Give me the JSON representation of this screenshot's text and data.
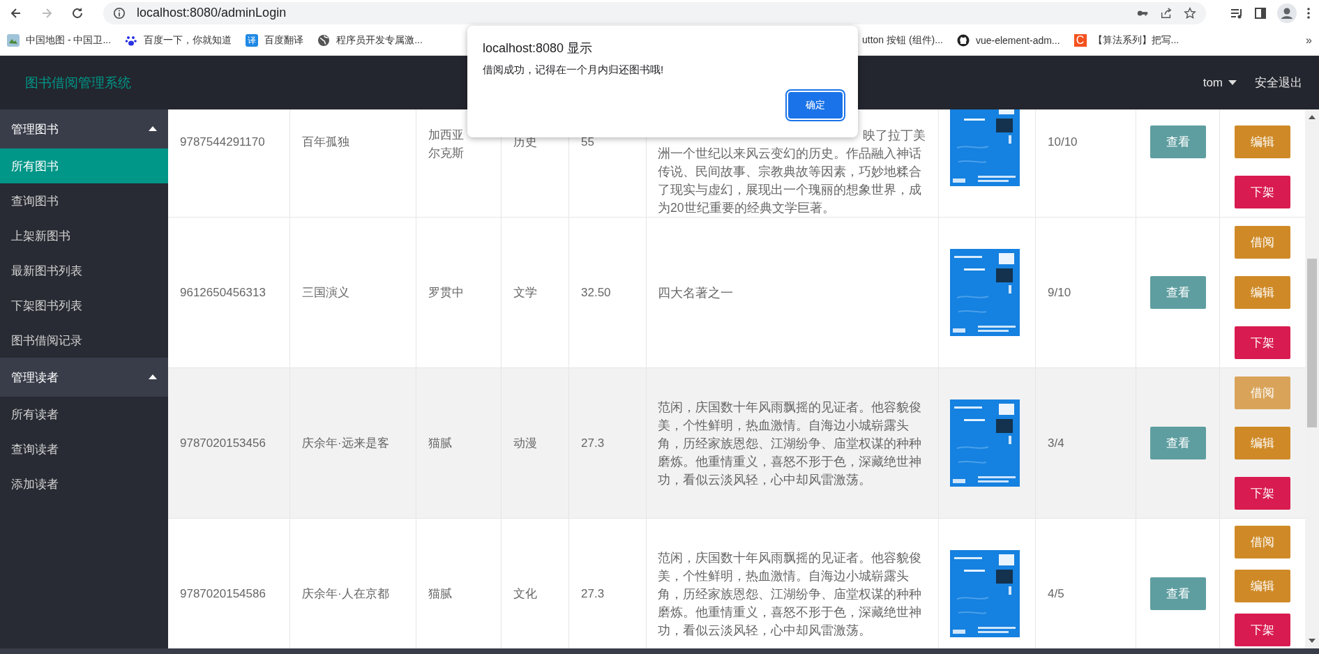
{
  "browser": {
    "forward_disabled": true,
    "url": "localhost:8080/adminLogin",
    "bookmarks": [
      {
        "title": "中国地图 - 中国卫..."
      },
      {
        "title": "百度一下，你就知道"
      },
      {
        "title": "百度翻译",
        "badge": "译",
        "color": "#1e88e5"
      },
      {
        "title": "程序员开发专属激..."
      }
    ],
    "bookmarks_right": [
      {
        "title": "utton 按钮 (组件)..."
      },
      {
        "title": "vue-element-adm..."
      },
      {
        "title": "【算法系列】把写...",
        "badge": "C",
        "color": "#f4511e"
      }
    ],
    "more": "»"
  },
  "app": {
    "title": "图书借阅管理系统",
    "user": "tom",
    "logout": "安全退出"
  },
  "sidebar": [
    {
      "title": "管理图书",
      "expanded": true,
      "items": [
        {
          "label": "所有图书",
          "selected": true
        },
        {
          "label": "查询图书",
          "selected": false
        },
        {
          "label": "上架新图书",
          "selected": false
        },
        {
          "label": "最新图书列表",
          "selected": false
        },
        {
          "label": "下架图书列表",
          "selected": false
        },
        {
          "label": "图书借阅记录",
          "selected": false
        }
      ]
    },
    {
      "title": "管理读者",
      "expanded": true,
      "items": [
        {
          "label": "所有读者",
          "selected": false
        },
        {
          "label": "查询读者",
          "selected": false
        },
        {
          "label": "添加读者",
          "selected": false
        }
      ]
    }
  ],
  "rows": [
    {
      "hovered": false,
      "isbn": "9787544291170",
      "title": "百年孤独",
      "author_lines": [
        "加西亚",
        "尔克斯"
      ],
      "category": "历史",
      "price": "55",
      "description_fragment": "映了拉丁美",
      "description": "洲一个世纪以来风云变幻的历史。作品融入神话传说、民间故事、宗教典故等因素，巧妙地糅合了现实与虚幻，展现出一个瑰丽的想象世界，成为20世纪重要的经典文学巨著。",
      "stock": "10/10",
      "view": "查看",
      "actions": [
        {
          "label": "编辑",
          "kind": "edit",
          "highlighted": false
        },
        {
          "label": "下架",
          "kind": "remove",
          "highlighted": false
        }
      ]
    },
    {
      "hovered": false,
      "isbn": "9612650456313",
      "title": "三国演义",
      "author_lines": [
        "罗贯中"
      ],
      "category": "文学",
      "price": "32.50",
      "description": "四大名著之一",
      "stock": "9/10",
      "view": "查看",
      "actions": [
        {
          "label": "借阅",
          "kind": "borrow",
          "highlighted": false
        },
        {
          "label": "编辑",
          "kind": "edit",
          "highlighted": false
        },
        {
          "label": "下架",
          "kind": "remove",
          "highlighted": false
        }
      ]
    },
    {
      "hovered": true,
      "isbn": "9787020153456",
      "title": "庆余年·远来是客",
      "author_lines": [
        "猫腻"
      ],
      "category": "动漫",
      "price": "27.3",
      "description": "范闲，庆国数十年风雨飘摇的见证者。他容貌俊美，个性鲜明，热血激情。自海边小城崭露头角，历经家族恩怨、江湖纷争、庙堂权谋的种种磨炼。他重情重义，喜怒不形于色，深藏绝世神功，看似云淡风轻，心中却风雷激荡。",
      "stock": "3/4",
      "view": "查看",
      "actions": [
        {
          "label": "借阅",
          "kind": "borrow",
          "highlighted": true
        },
        {
          "label": "编辑",
          "kind": "edit",
          "highlighted": false
        },
        {
          "label": "下架",
          "kind": "remove",
          "highlighted": false
        }
      ]
    },
    {
      "hovered": false,
      "isbn": "9787020154586",
      "title": "庆余年·人在京都",
      "author_lines": [
        "猫腻"
      ],
      "category": "文化",
      "price": "27.3",
      "description": "范闲，庆国数十年风雨飘摇的见证者。他容貌俊美，个性鲜明，热血激情。自海边小城崭露头角，历经家族恩怨、江湖纷争、庙堂权谋的种种磨炼。他重情重义，喜怒不形于色，深藏绝世神功，看似云淡风轻，心中却风雷激荡。",
      "stock": "4/5",
      "view": "查看",
      "actions": [
        {
          "label": "借阅",
          "kind": "borrow",
          "highlighted": false
        },
        {
          "label": "编辑",
          "kind": "edit",
          "highlighted": false
        },
        {
          "label": "下架",
          "kind": "remove",
          "highlighted": false
        }
      ]
    }
  ],
  "dialog": {
    "title": "localhost:8080 显示",
    "message": "借阅成功，记得在一个月内归还图书哦!",
    "ok": "确定"
  }
}
